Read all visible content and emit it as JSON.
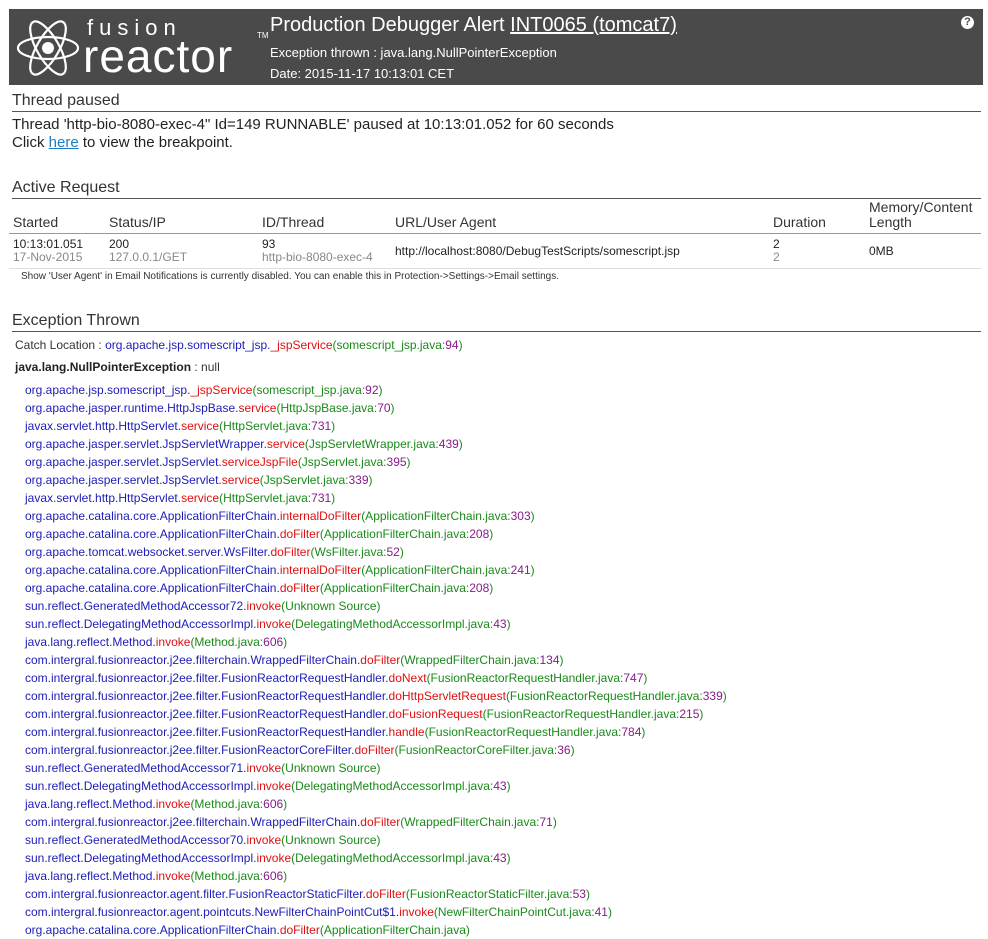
{
  "header": {
    "logo_word1": "fusion",
    "logo_word2": "reactor",
    "logo_tm": "TM",
    "title_prefix": "Production Debugger Alert",
    "title_link": "INT0065 (tomcat7)",
    "exception_line": "Exception thrown : java.lang.NullPointerException",
    "date_line": "Date: 2015-11-17 10:13:01 CET",
    "help_icon": "?"
  },
  "thread": {
    "section_title": "Thread paused",
    "line1": "Thread 'http-bio-8080-exec-4\" Id=149 RUNNABLE' paused at 10:13:01.052 for 60 seconds",
    "click_prefix": "Click",
    "click_link": "here",
    "click_suffix": "to view the breakpoint."
  },
  "active_request": {
    "section_title": "Active Request",
    "columns": [
      "Started",
      "Status/IP",
      "ID/Thread",
      "URL/User Agent",
      "Duration",
      "Memory/Content Length"
    ],
    "row": {
      "started": "10:13:01.051",
      "started_date": "17-Nov-2015",
      "status": "200",
      "ip": "127.0.0.1/GET",
      "id": "93",
      "thread": "http-bio-8080-exec-4",
      "url": "http://localhost:8080/DebugTestScripts/somescript.jsp",
      "duration1": "2",
      "duration2": "2",
      "memory": "0MB"
    },
    "note": "Show 'User Agent' in Email Notifications is currently disabled. You can enable this in Protection->Settings->Email settings."
  },
  "exception": {
    "section_title": "Exception Thrown",
    "catch_label": "Catch Location :",
    "catch_class": "org.apache.jsp.somescript_jsp.",
    "catch_method": "_jspService",
    "catch_src": "(somescript_jsp.java:",
    "catch_line": "94",
    "catch_close": ")",
    "exc_name": "java.lang.NullPointerException",
    "exc_msg": ": null",
    "frames": [
      {
        "cls": "org.apache.jsp.somescript_jsp.",
        "m": "_jspService",
        "src": "(somescript_jsp.java:",
        "ln": "92",
        "end": ")"
      },
      {
        "cls": "org.apache.jasper.runtime.HttpJspBase.",
        "m": "service",
        "src": "(HttpJspBase.java:",
        "ln": "70",
        "end": ")"
      },
      {
        "cls": "javax.servlet.http.HttpServlet.",
        "m": "service",
        "src": "(HttpServlet.java:",
        "ln": "731",
        "end": ")"
      },
      {
        "cls": "org.apache.jasper.servlet.JspServletWrapper.",
        "m": "service",
        "src": "(JspServletWrapper.java:",
        "ln": "439",
        "end": ")"
      },
      {
        "cls": "org.apache.jasper.servlet.JspServlet.",
        "m": "serviceJspFile",
        "src": "(JspServlet.java:",
        "ln": "395",
        "end": ")"
      },
      {
        "cls": "org.apache.jasper.servlet.JspServlet.",
        "m": "service",
        "src": "(JspServlet.java:",
        "ln": "339",
        "end": ")"
      },
      {
        "cls": "javax.servlet.http.HttpServlet.",
        "m": "service",
        "src": "(HttpServlet.java:",
        "ln": "731",
        "end": ")"
      },
      {
        "cls": "org.apache.catalina.core.ApplicationFilterChain.",
        "m": "internalDoFilter",
        "src": "(ApplicationFilterChain.java:",
        "ln": "303",
        "end": ")"
      },
      {
        "cls": "org.apache.catalina.core.ApplicationFilterChain.",
        "m": "doFilter",
        "src": "(ApplicationFilterChain.java:",
        "ln": "208",
        "end": ")"
      },
      {
        "cls": "org.apache.tomcat.websocket.server.WsFilter.",
        "m": "doFilter",
        "src": "(WsFilter.java:",
        "ln": "52",
        "end": ")"
      },
      {
        "cls": "org.apache.catalina.core.ApplicationFilterChain.",
        "m": "internalDoFilter",
        "src": "(ApplicationFilterChain.java:",
        "ln": "241",
        "end": ")"
      },
      {
        "cls": "org.apache.catalina.core.ApplicationFilterChain.",
        "m": "doFilter",
        "src": "(ApplicationFilterChain.java:",
        "ln": "208",
        "end": ")"
      },
      {
        "cls": "sun.reflect.GeneratedMethodAccessor72.",
        "m": "invoke",
        "src": "(Unknown Source)",
        "ln": "",
        "end": ""
      },
      {
        "cls": "sun.reflect.DelegatingMethodAccessorImpl.",
        "m": "invoke",
        "src": "(DelegatingMethodAccessorImpl.java:",
        "ln": "43",
        "end": ")"
      },
      {
        "cls": "java.lang.reflect.Method.",
        "m": "invoke",
        "src": "(Method.java:",
        "ln": "606",
        "end": ")"
      },
      {
        "cls": "com.intergral.fusionreactor.j2ee.filterchain.WrappedFilterChain.",
        "m": "doFilter",
        "src": "(WrappedFilterChain.java:",
        "ln": "134",
        "end": ")"
      },
      {
        "cls": "com.intergral.fusionreactor.j2ee.filter.FusionReactorRequestHandler.",
        "m": "doNext",
        "src": "(FusionReactorRequestHandler.java:",
        "ln": "747",
        "end": ")"
      },
      {
        "cls": "com.intergral.fusionreactor.j2ee.filter.FusionReactorRequestHandler.",
        "m": "doHttpServletRequest",
        "src": "(FusionReactorRequestHandler.java:",
        "ln": "339",
        "end": ")"
      },
      {
        "cls": "com.intergral.fusionreactor.j2ee.filter.FusionReactorRequestHandler.",
        "m": "doFusionRequest",
        "src": "(FusionReactorRequestHandler.java:",
        "ln": "215",
        "end": ")"
      },
      {
        "cls": "com.intergral.fusionreactor.j2ee.filter.FusionReactorRequestHandler.",
        "m": "handle",
        "src": "(FusionReactorRequestHandler.java:",
        "ln": "784",
        "end": ")"
      },
      {
        "cls": "com.intergral.fusionreactor.j2ee.filter.FusionReactorCoreFilter.",
        "m": "doFilter",
        "src": "(FusionReactorCoreFilter.java:",
        "ln": "36",
        "end": ")"
      },
      {
        "cls": "sun.reflect.GeneratedMethodAccessor71.",
        "m": "invoke",
        "src": "(Unknown Source)",
        "ln": "",
        "end": ""
      },
      {
        "cls": "sun.reflect.DelegatingMethodAccessorImpl.",
        "m": "invoke",
        "src": "(DelegatingMethodAccessorImpl.java:",
        "ln": "43",
        "end": ")"
      },
      {
        "cls": "java.lang.reflect.Method.",
        "m": "invoke",
        "src": "(Method.java:",
        "ln": "606",
        "end": ")"
      },
      {
        "cls": "com.intergral.fusionreactor.j2ee.filterchain.WrappedFilterChain.",
        "m": "doFilter",
        "src": "(WrappedFilterChain.java:",
        "ln": "71",
        "end": ")"
      },
      {
        "cls": "sun.reflect.GeneratedMethodAccessor70.",
        "m": "invoke",
        "src": "(Unknown Source)",
        "ln": "",
        "end": ""
      },
      {
        "cls": "sun.reflect.DelegatingMethodAccessorImpl.",
        "m": "invoke",
        "src": "(DelegatingMethodAccessorImpl.java:",
        "ln": "43",
        "end": ")"
      },
      {
        "cls": "java.lang.reflect.Method.",
        "m": "invoke",
        "src": "(Method.java:",
        "ln": "606",
        "end": ")"
      },
      {
        "cls": "com.intergral.fusionreactor.agent.filter.FusionReactorStaticFilter.",
        "m": "doFilter",
        "src": "(FusionReactorStaticFilter.java:",
        "ln": "53",
        "end": ")"
      },
      {
        "cls": "com.intergral.fusionreactor.agent.pointcuts.NewFilterChainPointCut$1.",
        "m": "invoke",
        "src": "(NewFilterChainPointCut.java:",
        "ln": "41",
        "end": ")"
      },
      {
        "cls": "org.apache.catalina.core.ApplicationFilterChain.",
        "m": "doFilter",
        "src": "(ApplicationFilterChain.java",
        "ln": "",
        "end": ")"
      }
    ]
  }
}
